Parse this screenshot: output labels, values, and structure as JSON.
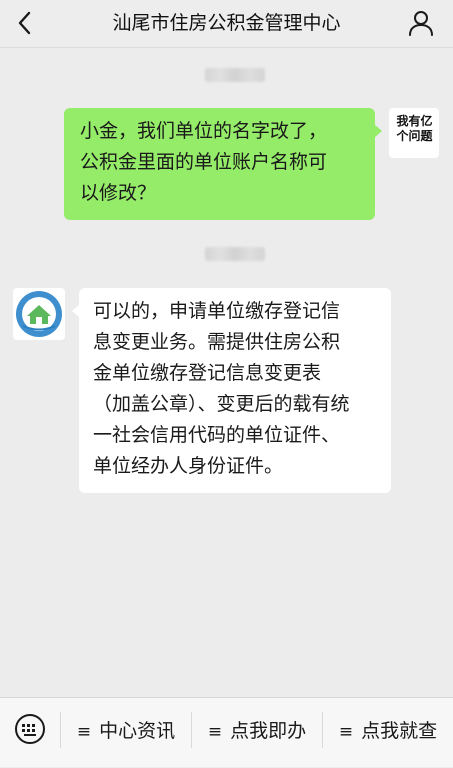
{
  "header": {
    "title": "汕尾市住房公积金管理中心",
    "back_icon": "chevron-left-icon",
    "user_icon": "person-icon"
  },
  "messages": [
    {
      "side": "out",
      "lines": [
        "小金，我们单位的名字改了，",
        "公积金里面的单位账户名称可",
        "以修改？"
      ]
    },
    {
      "side": "in",
      "lines": [
        "可以的，申请单位缴存登记信",
        "息变更业务。需提供住房公积",
        "金单位缴存登记信息变更表",
        "（加盖公章）、变更后的载有统",
        "一社会信用代码的单位证件、",
        "单位经办人身份证件。"
      ]
    }
  ],
  "user_avatar": {
    "line1": "我有亿",
    "line2": "个问题"
  },
  "bot_avatar": {
    "icon": "housing-fund-logo-icon"
  },
  "footer": {
    "keyboard_icon": "keyboard-icon",
    "menu_mark": "≡",
    "menus": [
      "中心资讯",
      "点我即办",
      "点我就查"
    ]
  },
  "colors": {
    "sent_bubble": "#95ec69",
    "received_bubble": "#ffffff",
    "background": "#ececec"
  }
}
